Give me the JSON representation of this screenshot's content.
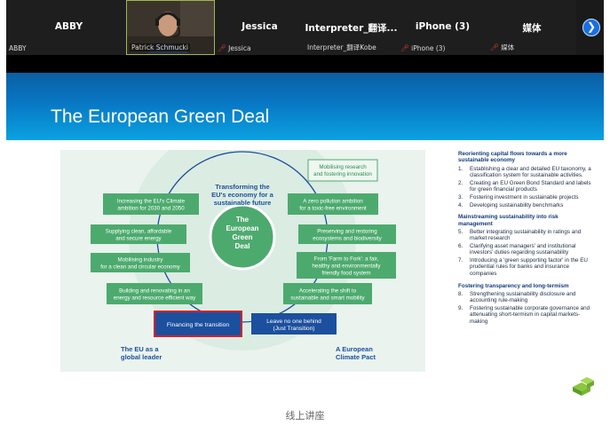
{
  "participants": [
    {
      "display": "ABBY",
      "label": "ABBY",
      "muted": false
    },
    {
      "display": "",
      "label": "Patrick Schmucki",
      "muted": false,
      "active": true
    },
    {
      "display": "Jessica",
      "label": "Jessica",
      "muted": true
    },
    {
      "display": "Interpreter_翻译...",
      "label": "Interpreter_翻译Kobe",
      "muted": false
    },
    {
      "display": "iPhone (3)",
      "label": "iPhone (3)",
      "muted": true
    },
    {
      "display": "媒体",
      "label": "媒体",
      "muted": true
    }
  ],
  "next_icon": "chevron-right-icon",
  "slide": {
    "title": "The European Green Deal",
    "diagram": {
      "center": [
        "The",
        "European",
        "Green",
        "Deal"
      ],
      "top_label": [
        "Transforming the",
        "EU's economy for a",
        "sustainable future"
      ],
      "top_right_box": [
        "Mobilising research",
        "and fostering innovation"
      ],
      "left_boxes": [
        [
          "Increasing the EU's Climate",
          "ambition for 2030 and 2050"
        ],
        [
          "Supplying clean, affordable",
          "and secure energy"
        ],
        [
          "Mobilising industry",
          "for a clean and circular economy"
        ],
        [
          "Building and renovating in an",
          "energy and resource efficient way"
        ]
      ],
      "right_boxes": [
        [
          "A zero pollution ambition",
          "for a toxic-free environment"
        ],
        [
          "Preserving and restoring",
          "ecosystems and biodiversity"
        ],
        [
          "From 'Farm to Fork': a fair,",
          "healthy and environmentally",
          "friendly food system"
        ],
        [
          "Accelerating the shift to",
          "sustainable and smart mobility"
        ]
      ],
      "bottom_left_box": "Financing the transition",
      "bottom_right_box": [
        "Leave no one behind",
        "(Just Transition)"
      ],
      "footer_left": [
        "The EU as a",
        "global leader"
      ],
      "footer_right": [
        "A European",
        "Climate Pact"
      ]
    },
    "sections": [
      {
        "heading": "Reorienting capital flows towards a more sustainable economy",
        "items": [
          {
            "n": "1.",
            "text": "Establishing a clear and detailed EU taxonomy, a classification system for sustainable activities."
          },
          {
            "n": "2.",
            "text": "Creating an EU Green Bond Standard and labels for green financial products"
          },
          {
            "n": "3.",
            "text": "Fostering investment in sustainable projects"
          },
          {
            "n": "4.",
            "text": "Developing sustainability benchmarks"
          }
        ]
      },
      {
        "heading": "Mainstreaming sustainability into risk management",
        "items": [
          {
            "n": "5.",
            "text": "Better integrating sustainability in ratings and market research"
          },
          {
            "n": "6.",
            "text": "Clarifying asset managers' and institutional investors' duties regarding sustainability"
          },
          {
            "n": "7.",
            "text": "Introducing a 'green supporting factor' in the EU prudential rules for banks and insurance companies"
          }
        ]
      },
      {
        "heading": "Fostering transparency and long-termism",
        "items": [
          {
            "n": "8.",
            "text": "Strengthening sustainability disclosure and accounting rule-making"
          },
          {
            "n": "9.",
            "text": "Fostering sustainable corporate governance and attenuating short-termism in capital markets-making"
          }
        ]
      }
    ]
  },
  "caption": "线上讲座",
  "colors": {
    "accent_blue": "#1a6fe0",
    "box_green": "#4daa6e",
    "box_blue": "#1c4f9e",
    "highlight_red": "#d2232a"
  }
}
